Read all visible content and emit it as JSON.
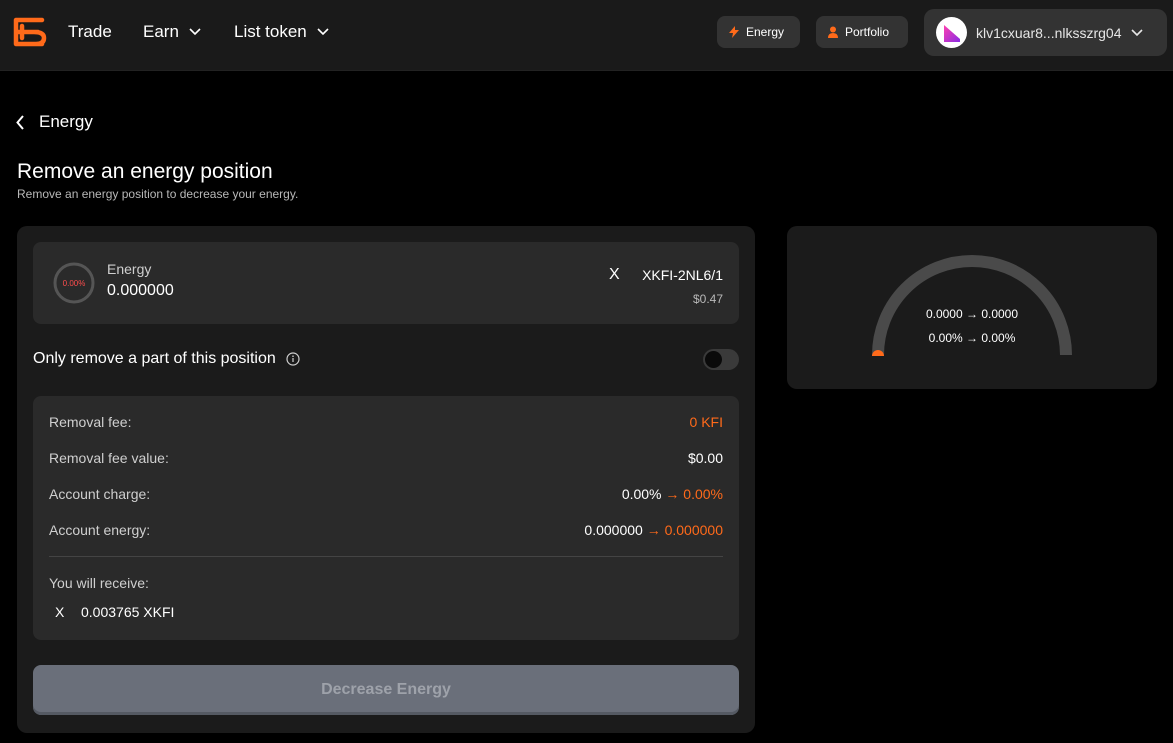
{
  "header": {
    "nav": [
      {
        "label": "Trade"
      },
      {
        "label": "Earn"
      },
      {
        "label": "List token"
      }
    ],
    "energy_button": "Energy",
    "portfolio_button": "Portfolio",
    "wallet_address": "klv1cxuar8...nlksszrg04"
  },
  "back_label": "Energy",
  "page": {
    "title": "Remove an energy position",
    "subtitle": "Remove an energy position to decrease your energy."
  },
  "position": {
    "ring_percent": "0.00%",
    "energy_label": "Energy",
    "energy_value": "0.000000",
    "token_symbol_glyph": "X",
    "token_name": "XKFI-2NL6/1",
    "token_usd": "$0.47"
  },
  "partial_label": "Only remove a part of this position",
  "details": {
    "removal_fee_label": "Removal fee:",
    "removal_fee_value": "0 KFI",
    "removal_fee_value_label": "Removal fee value:",
    "removal_fee_value_value": "$0.00",
    "account_charge_label": "Account charge:",
    "account_charge_from": "0.00%",
    "account_charge_to": "→ 0.00%",
    "account_energy_label": "Account energy:",
    "account_energy_from": "0.000000",
    "account_energy_to": "→ 0.000000",
    "receive_label": "You will receive:",
    "receive_glyph": "X",
    "receive_amount": "0.003765 XKFI"
  },
  "submit_label": "Decrease Energy",
  "gauge": {
    "line1": "0.0000 → 0.0000",
    "line2": "0.00% → 0.00%",
    "level": 0
  },
  "colors": {
    "accent": "#ff6a1a",
    "background": "#000000",
    "card": "#1b1b1b",
    "panel": "#2a2a2a"
  }
}
